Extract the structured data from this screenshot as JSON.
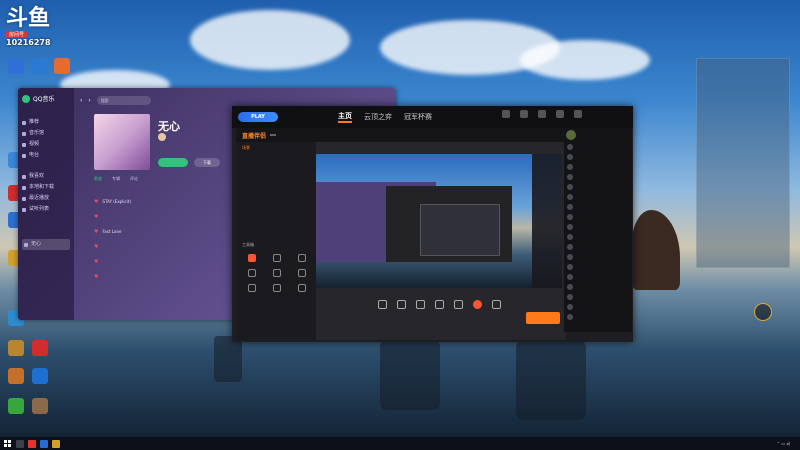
{
  "overlay": {
    "logo_text": "斗鱼",
    "tag": "房间号",
    "room_number": "10216278"
  },
  "desktop_icons": [
    {
      "name": "recycle-bin-icon",
      "label": "",
      "color": "#2f6fd6"
    },
    {
      "name": "app-icon-2",
      "label": "",
      "color": "#2a7ad1"
    },
    {
      "name": "app-icon-3",
      "label": "",
      "color": "#e86b2d"
    },
    {
      "name": "app-icon-4",
      "label": "",
      "color": "#3a86d8"
    },
    {
      "name": "app-icon-5",
      "label": "",
      "color": "#d12d2d"
    },
    {
      "name": "app-icon-6",
      "label": "",
      "color": "#2d6fd1"
    },
    {
      "name": "app-icon-7",
      "label": "",
      "color": "#d1a02d"
    }
  ],
  "desktop_bottom_icons": [
    {
      "name": "app-icon-qq",
      "label": "",
      "color": "#2d8cd1"
    },
    {
      "name": "app-icon-game1",
      "label": "",
      "color": "#b8862e"
    },
    {
      "name": "app-icon-netease",
      "label": "",
      "color": "#d12d2d"
    },
    {
      "name": "app-icon-game2",
      "label": "",
      "color": "#c3702c"
    },
    {
      "name": "app-icon-blue",
      "label": "",
      "color": "#1f6fd1"
    },
    {
      "name": "app-icon-play",
      "label": "",
      "color": "#37a63c"
    },
    {
      "name": "app-icon-game3",
      "label": "",
      "color": "#8a6a4a"
    }
  ],
  "qq_music": {
    "brand": "QQ音乐",
    "search_placeholder": "搜索",
    "nav": [
      "推荐",
      "音乐馆",
      "视频",
      "电台"
    ],
    "group": [
      "我喜欢",
      "本地和下载",
      "最近播放",
      "试听列表"
    ],
    "playlist_title": "无心",
    "username": "",
    "cover_tag": "",
    "play_all": "",
    "download": "下载",
    "tabs": [
      "歌曲",
      "专辑",
      "评论"
    ],
    "songs": [
      "STAY (Explicit)",
      "",
      "Fast Lane",
      "",
      "",
      ""
    ],
    "bottom_track": "",
    "bottom_artist": ""
  },
  "douyu": {
    "play_label": "PLAY",
    "tabs": [
      "主页",
      "云顶之弈",
      "冠军杯赛"
    ],
    "top_icons": [
      "",
      "",
      "",
      "",
      ""
    ],
    "companion_logo": "直播伴侣",
    "companion_version": "",
    "scenes": [
      "场景",
      "",
      ""
    ],
    "tool_section_label": "工具箱",
    "tools": [
      "",
      "",
      "",
      "",
      "",
      "",
      "",
      "",
      ""
    ],
    "preview_chips": [
      "",
      "",
      ""
    ],
    "bottom_buttons": [
      "",
      "",
      "",
      "",
      "",
      "",
      ""
    ],
    "start_button": "",
    "status": "",
    "status_right": [
      "",
      "",
      ""
    ],
    "chat_title": "",
    "chat_rows": [
      "",
      "",
      "",
      "",
      "",
      "",
      "",
      "",
      "",
      "",
      "",
      "",
      "",
      "",
      "",
      "",
      "",
      ""
    ]
  },
  "danmaku": {
    "lines": [
      "",
      "",
      "",
      "",
      "",
      "",
      "",
      "",
      "",
      "",
      ""
    ]
  },
  "badge": "",
  "taskbar": {
    "time": "",
    "date": "",
    "apps": [
      {
        "name": "search-taskbar-icon",
        "color": "#3a3f4a"
      },
      {
        "name": "app-taskbar-1",
        "color": "#e1352c"
      },
      {
        "name": "app-taskbar-2",
        "color": "#2a6ad1"
      },
      {
        "name": "app-taskbar-3",
        "color": "#d1a02d"
      }
    ]
  }
}
